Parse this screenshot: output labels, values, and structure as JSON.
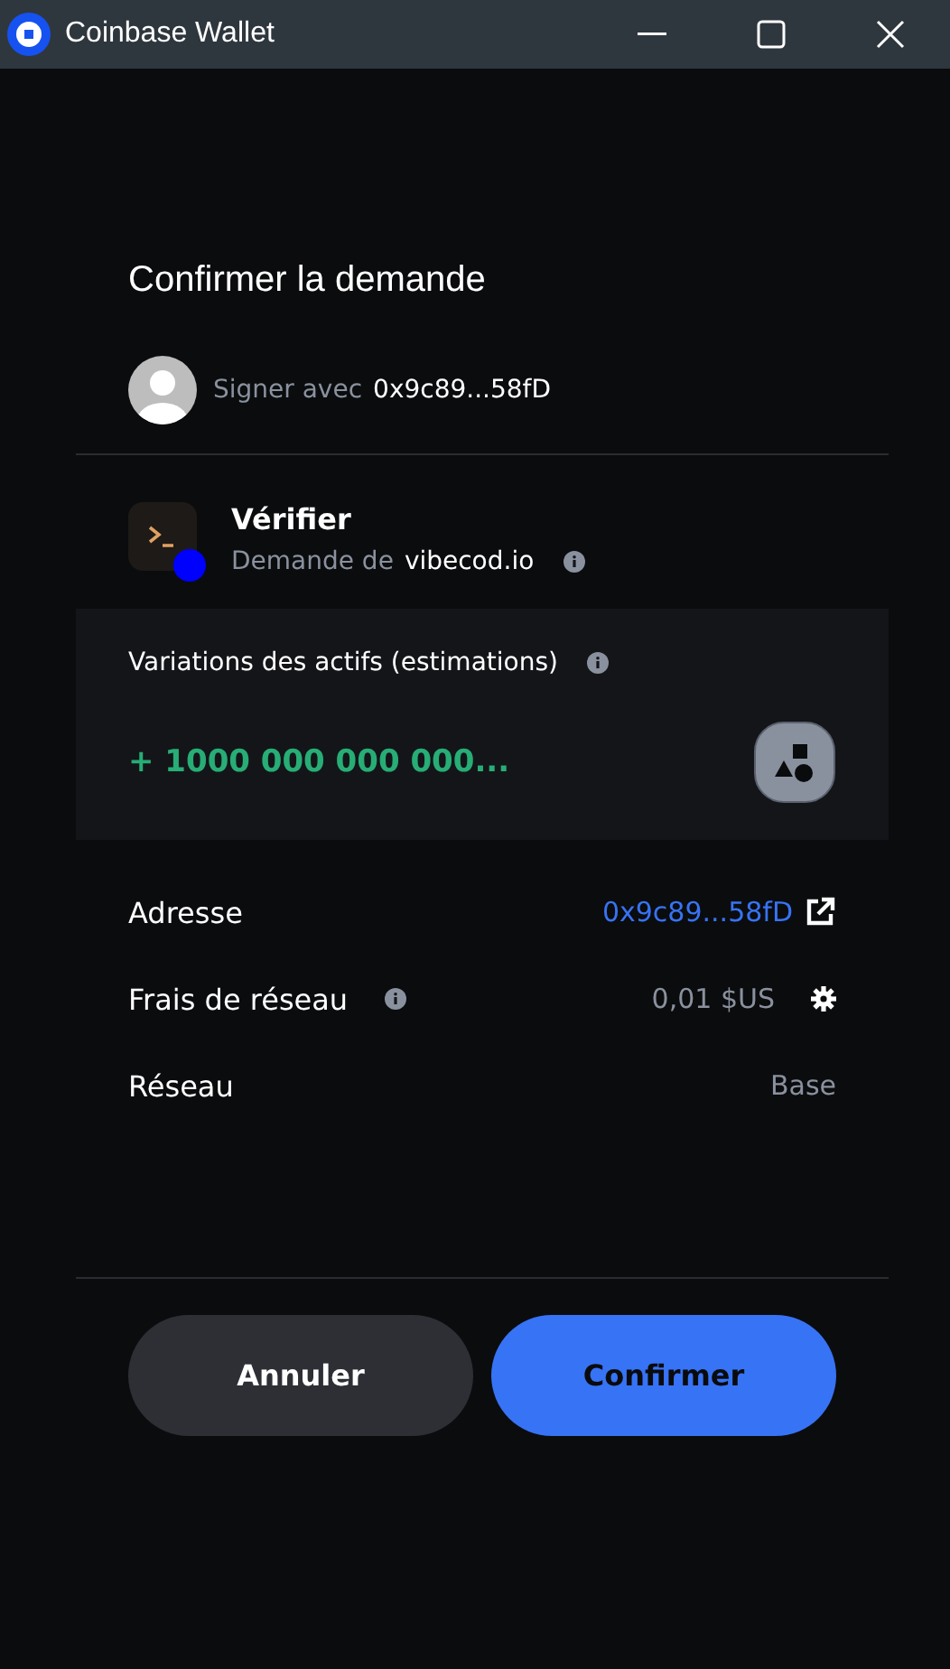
{
  "window": {
    "title": "Coinbase Wallet"
  },
  "heading": "Confirmer la demande",
  "signer": {
    "prefix": "Signer avec",
    "address": "0x9c89...58fD"
  },
  "request": {
    "title": "Vérifier",
    "prefix": "Demande de",
    "origin": "vibecod.io"
  },
  "assets": {
    "title": "Variations des actifs (estimations)",
    "amount": "+ 1000 000 000 000..."
  },
  "details": [
    {
      "kind": "link",
      "label": "Adresse",
      "value": "0x9c89...58fD"
    },
    {
      "kind": "fee",
      "label": "Frais de réseau",
      "value": "0,01 $US"
    },
    {
      "kind": "plain",
      "label": "Réseau",
      "value": "Base"
    }
  ],
  "buttons": [
    {
      "kind": "secondary",
      "label": "Annuler"
    },
    {
      "kind": "primary",
      "label": "Confirmer"
    }
  ]
}
